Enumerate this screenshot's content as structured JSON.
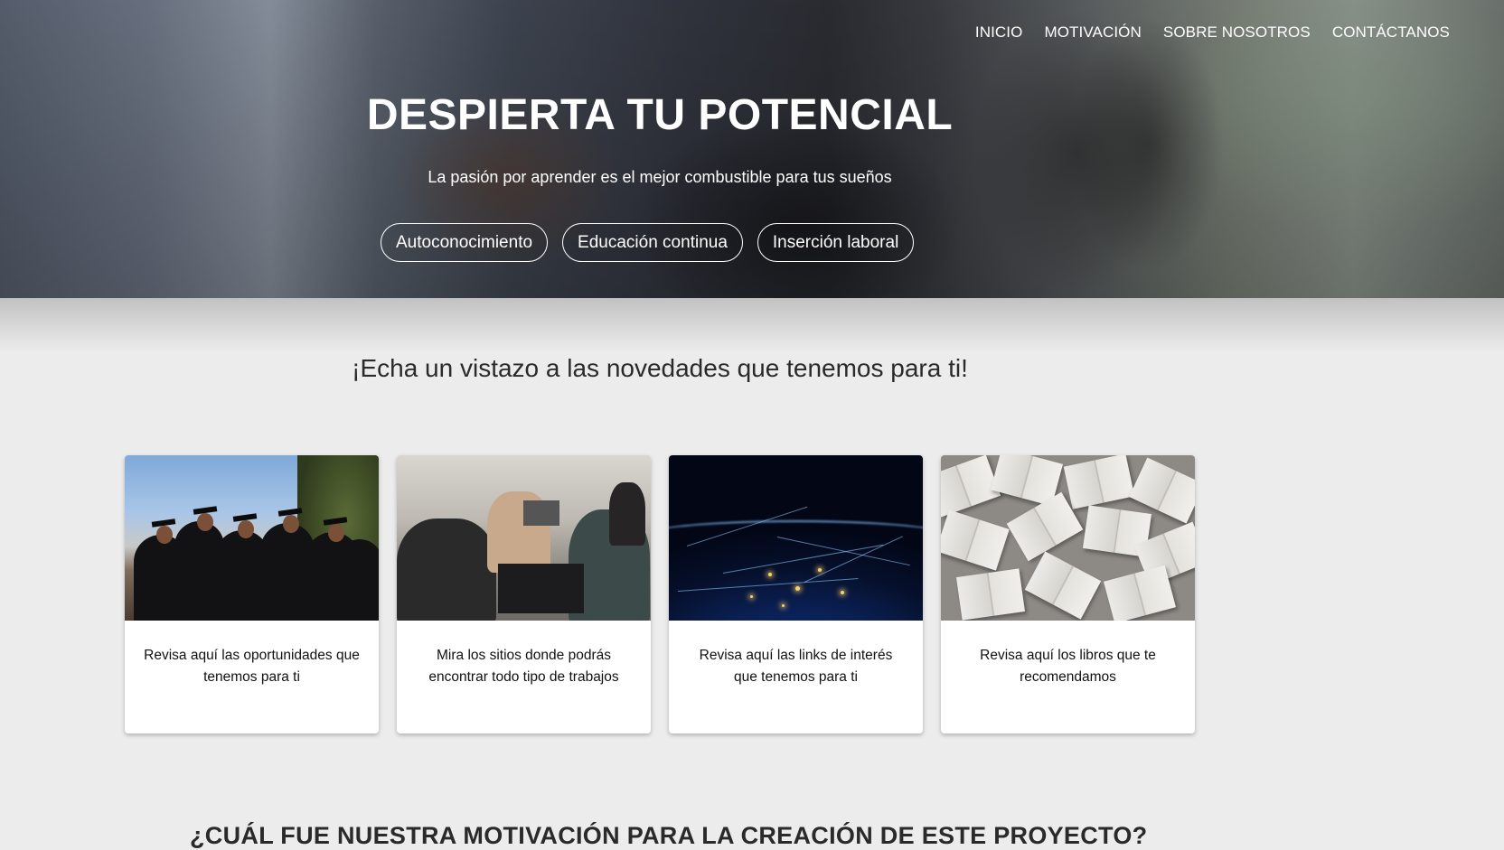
{
  "nav": {
    "items": [
      {
        "label": "INICIO"
      },
      {
        "label": "MOTIVACIÓN"
      },
      {
        "label": "SOBRE NOSOTROS"
      },
      {
        "label": "CONTÁCTANOS"
      }
    ]
  },
  "hero": {
    "title": "DESPIERTA TU POTENCIAL",
    "subtitle": "La pasión por aprender es el mejor combustible para tus sueños",
    "pills": [
      {
        "label": "Autoconocimiento"
      },
      {
        "label": "Educación continua"
      },
      {
        "label": "Inserción laboral"
      }
    ]
  },
  "news": {
    "title": "¡Echa un vistazo a las novedades que tenemos para ti!",
    "cards": [
      {
        "text": "Revisa aquí las oportunidades que tenemos para ti",
        "image": "graduates-photo"
      },
      {
        "text": "Mira los sitios donde podrás encontrar todo tipo de trabajos",
        "image": "office-workers-photo"
      },
      {
        "text": "Revisa aquí las links de interés que tenemos para ti",
        "image": "earth-network-photo"
      },
      {
        "text": "Revisa aquí los libros que te recomendamos",
        "image": "open-books-photo"
      }
    ]
  },
  "motivation": {
    "title": "¿CUÁL FUE NUESTRA MOTIVACIÓN PARA LA CREACIÓN DE ESTE PROYECTO?"
  }
}
